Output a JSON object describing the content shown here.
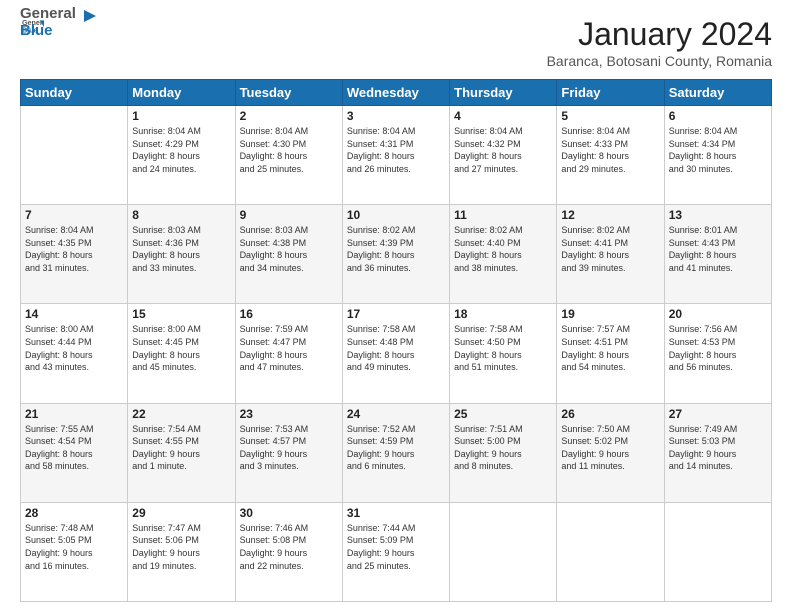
{
  "header": {
    "logo": {
      "line1": "General",
      "line2": "Blue"
    },
    "title": "January 2024",
    "location": "Baranca, Botosani County, Romania"
  },
  "calendar": {
    "columns": [
      "Sunday",
      "Monday",
      "Tuesday",
      "Wednesday",
      "Thursday",
      "Friday",
      "Saturday"
    ],
    "weeks": [
      [
        {
          "day": "",
          "info": ""
        },
        {
          "day": "1",
          "info": "Sunrise: 8:04 AM\nSunset: 4:29 PM\nDaylight: 8 hours\nand 24 minutes."
        },
        {
          "day": "2",
          "info": "Sunrise: 8:04 AM\nSunset: 4:30 PM\nDaylight: 8 hours\nand 25 minutes."
        },
        {
          "day": "3",
          "info": "Sunrise: 8:04 AM\nSunset: 4:31 PM\nDaylight: 8 hours\nand 26 minutes."
        },
        {
          "day": "4",
          "info": "Sunrise: 8:04 AM\nSunset: 4:32 PM\nDaylight: 8 hours\nand 27 minutes."
        },
        {
          "day": "5",
          "info": "Sunrise: 8:04 AM\nSunset: 4:33 PM\nDaylight: 8 hours\nand 29 minutes."
        },
        {
          "day": "6",
          "info": "Sunrise: 8:04 AM\nSunset: 4:34 PM\nDaylight: 8 hours\nand 30 minutes."
        }
      ],
      [
        {
          "day": "7",
          "info": "Sunrise: 8:04 AM\nSunset: 4:35 PM\nDaylight: 8 hours\nand 31 minutes."
        },
        {
          "day": "8",
          "info": "Sunrise: 8:03 AM\nSunset: 4:36 PM\nDaylight: 8 hours\nand 33 minutes."
        },
        {
          "day": "9",
          "info": "Sunrise: 8:03 AM\nSunset: 4:38 PM\nDaylight: 8 hours\nand 34 minutes."
        },
        {
          "day": "10",
          "info": "Sunrise: 8:02 AM\nSunset: 4:39 PM\nDaylight: 8 hours\nand 36 minutes."
        },
        {
          "day": "11",
          "info": "Sunrise: 8:02 AM\nSunset: 4:40 PM\nDaylight: 8 hours\nand 38 minutes."
        },
        {
          "day": "12",
          "info": "Sunrise: 8:02 AM\nSunset: 4:41 PM\nDaylight: 8 hours\nand 39 minutes."
        },
        {
          "day": "13",
          "info": "Sunrise: 8:01 AM\nSunset: 4:43 PM\nDaylight: 8 hours\nand 41 minutes."
        }
      ],
      [
        {
          "day": "14",
          "info": "Sunrise: 8:00 AM\nSunset: 4:44 PM\nDaylight: 8 hours\nand 43 minutes."
        },
        {
          "day": "15",
          "info": "Sunrise: 8:00 AM\nSunset: 4:45 PM\nDaylight: 8 hours\nand 45 minutes."
        },
        {
          "day": "16",
          "info": "Sunrise: 7:59 AM\nSunset: 4:47 PM\nDaylight: 8 hours\nand 47 minutes."
        },
        {
          "day": "17",
          "info": "Sunrise: 7:58 AM\nSunset: 4:48 PM\nDaylight: 8 hours\nand 49 minutes."
        },
        {
          "day": "18",
          "info": "Sunrise: 7:58 AM\nSunset: 4:50 PM\nDaylight: 8 hours\nand 51 minutes."
        },
        {
          "day": "19",
          "info": "Sunrise: 7:57 AM\nSunset: 4:51 PM\nDaylight: 8 hours\nand 54 minutes."
        },
        {
          "day": "20",
          "info": "Sunrise: 7:56 AM\nSunset: 4:53 PM\nDaylight: 8 hours\nand 56 minutes."
        }
      ],
      [
        {
          "day": "21",
          "info": "Sunrise: 7:55 AM\nSunset: 4:54 PM\nDaylight: 8 hours\nand 58 minutes."
        },
        {
          "day": "22",
          "info": "Sunrise: 7:54 AM\nSunset: 4:55 PM\nDaylight: 9 hours\nand 1 minute."
        },
        {
          "day": "23",
          "info": "Sunrise: 7:53 AM\nSunset: 4:57 PM\nDaylight: 9 hours\nand 3 minutes."
        },
        {
          "day": "24",
          "info": "Sunrise: 7:52 AM\nSunset: 4:59 PM\nDaylight: 9 hours\nand 6 minutes."
        },
        {
          "day": "25",
          "info": "Sunrise: 7:51 AM\nSunset: 5:00 PM\nDaylight: 9 hours\nand 8 minutes."
        },
        {
          "day": "26",
          "info": "Sunrise: 7:50 AM\nSunset: 5:02 PM\nDaylight: 9 hours\nand 11 minutes."
        },
        {
          "day": "27",
          "info": "Sunrise: 7:49 AM\nSunset: 5:03 PM\nDaylight: 9 hours\nand 14 minutes."
        }
      ],
      [
        {
          "day": "28",
          "info": "Sunrise: 7:48 AM\nSunset: 5:05 PM\nDaylight: 9 hours\nand 16 minutes."
        },
        {
          "day": "29",
          "info": "Sunrise: 7:47 AM\nSunset: 5:06 PM\nDaylight: 9 hours\nand 19 minutes."
        },
        {
          "day": "30",
          "info": "Sunrise: 7:46 AM\nSunset: 5:08 PM\nDaylight: 9 hours\nand 22 minutes."
        },
        {
          "day": "31",
          "info": "Sunrise: 7:44 AM\nSunset: 5:09 PM\nDaylight: 9 hours\nand 25 minutes."
        },
        {
          "day": "",
          "info": ""
        },
        {
          "day": "",
          "info": ""
        },
        {
          "day": "",
          "info": ""
        }
      ]
    ]
  }
}
